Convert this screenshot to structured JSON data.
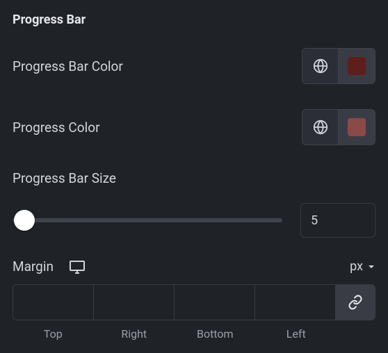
{
  "section": {
    "title": "Progress Bar"
  },
  "barColor": {
    "label": "Progress Bar Color",
    "swatch": "#5e1f1c"
  },
  "progressColor": {
    "label": "Progress Color",
    "swatch": "#8a4a47"
  },
  "size": {
    "label": "Progress Bar Size",
    "value": "5"
  },
  "margin": {
    "label": "Margin",
    "unit": "px",
    "top": "",
    "right": "",
    "bottom": "",
    "left": "",
    "sub": {
      "top": "Top",
      "right": "Right",
      "bottom": "Bottom",
      "left": "Left"
    }
  }
}
